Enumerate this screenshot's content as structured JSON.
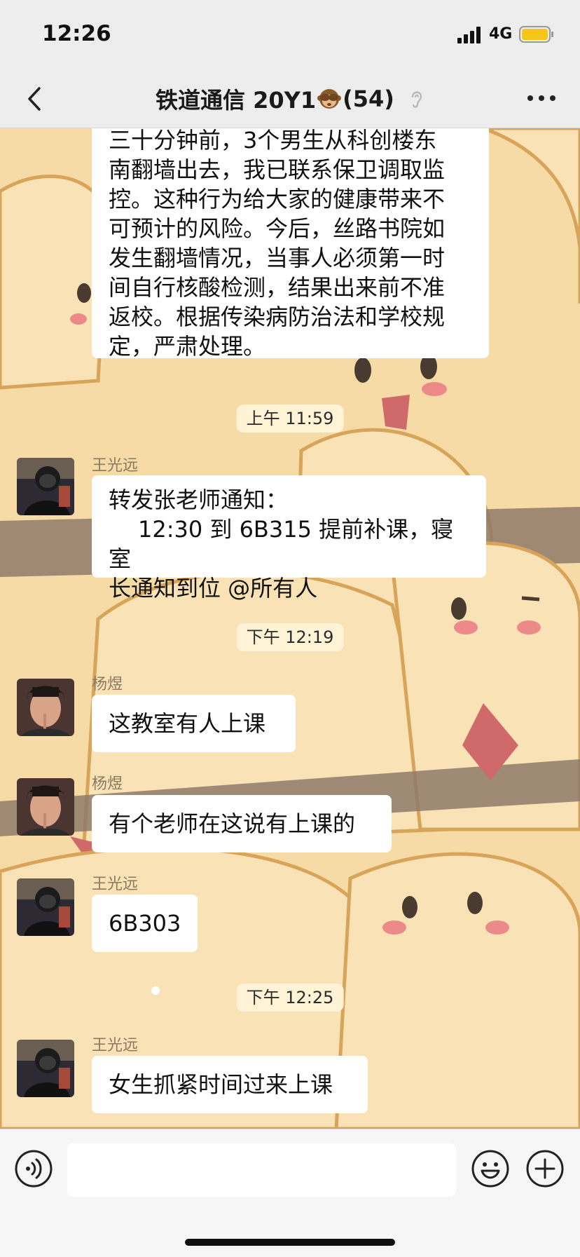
{
  "status_bar": {
    "time": "12:26",
    "network": "4G"
  },
  "header": {
    "title_text": "铁道通信 20Y1",
    "member_count": "(54)"
  },
  "messages": [
    {
      "type": "text",
      "lines": [
        "三十分钟前，3个男生从科创楼东",
        "南翻墙出去，我已联系保卫调取监",
        "控。这种行为给大家的健康带来不",
        "可预计的风险。今后，丝路书院如",
        "发生翻墙情况，当事人必须第一时",
        "间自行核酸检测，结果出来前不准",
        "返校。根据传染病防治法和学校规",
        "定，严肃处理。"
      ]
    },
    {
      "type": "timestamp",
      "text": "上午 11:59"
    },
    {
      "type": "text",
      "sender": "王光远",
      "lines": [
        "转发张老师通知：",
        "12:30 到 6B315 提前补课，寝室",
        "长通知到位 @所有人"
      ]
    },
    {
      "type": "timestamp",
      "text": "下午 12:19"
    },
    {
      "type": "text",
      "sender": "杨煜",
      "lines": [
        "这教室有人上课"
      ]
    },
    {
      "type": "text",
      "sender": "杨煜",
      "lines": [
        "有个老师在这说有上课的"
      ]
    },
    {
      "type": "text",
      "sender": "王光远",
      "lines": [
        "6B303"
      ]
    },
    {
      "type": "timestamp",
      "text": "下午 12:25"
    },
    {
      "type": "text",
      "sender": "王光远",
      "lines": [
        "女生抓紧时间过来上课"
      ]
    }
  ],
  "icons": {
    "back": "chevron-left-icon",
    "title_emoji": "see-no-evil-monkey-icon",
    "ear": "ear-icon",
    "more": "more-dots-icon",
    "voice": "voice-icon",
    "emoji": "emoji-icon",
    "plus": "plus-icon"
  },
  "colors": {
    "chat_background": "#f6dba6",
    "bubble": "#ffffff",
    "nav_background": "#ededed"
  }
}
